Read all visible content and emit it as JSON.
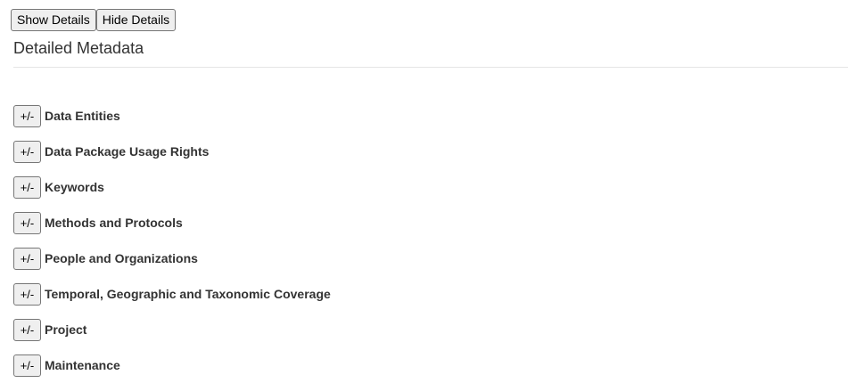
{
  "toolbar": {
    "show_details_label": "Show Details",
    "hide_details_label": "Hide Details"
  },
  "page_title": "Detailed Metadata",
  "toggle_label": "+/-",
  "sections": [
    {
      "label": "Data Entities"
    },
    {
      "label": "Data Package Usage Rights"
    },
    {
      "label": "Keywords"
    },
    {
      "label": "Methods and Protocols"
    },
    {
      "label": "People and Organizations"
    },
    {
      "label": "Temporal, Geographic and Taxonomic Coverage"
    },
    {
      "label": "Project"
    },
    {
      "label": "Maintenance"
    }
  ]
}
